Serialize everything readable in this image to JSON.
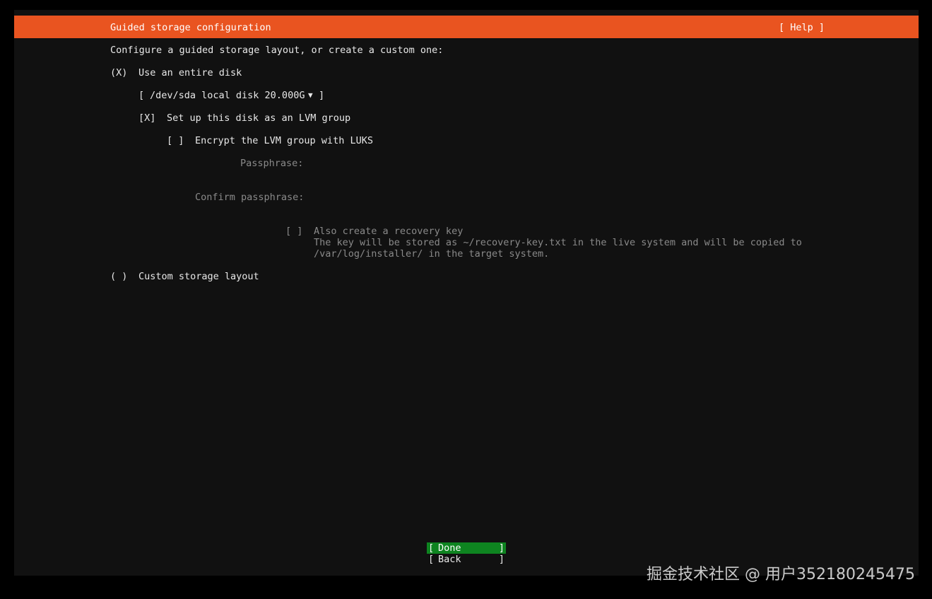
{
  "header": {
    "title": "Guided storage configuration",
    "help_label": "[ Help ]"
  },
  "main": {
    "intro": "Configure a guided storage layout, or create a custom one:",
    "entire_disk": {
      "mark": "(X)",
      "label": "Use an entire disk",
      "selected": true
    },
    "disk_select": {
      "open": "[",
      "value": "/dev/sda local disk 20.000G",
      "arrow": "▼",
      "close": "]"
    },
    "lvm": {
      "mark": "[X]",
      "label": "Set up this disk as an LVM group",
      "checked": true
    },
    "encrypt": {
      "mark": "[ ]",
      "label": "Encrypt the LVM group with LUKS",
      "checked": false
    },
    "passphrase": {
      "label": "Passphrase:",
      "value": ""
    },
    "confirm_passphrase": {
      "label": "Confirm passphrase:",
      "value": ""
    },
    "recovery_key": {
      "mark": "[ ]",
      "label": "Also create a recovery key",
      "help_line1": "The key will be stored as ~/recovery-key.txt in the live system and will be copied to",
      "help_line2": "/var/log/installer/ in the target system.",
      "checked": false
    },
    "custom_layout": {
      "mark": "( )",
      "label": "Custom storage layout",
      "selected": false
    }
  },
  "buttons": {
    "done": {
      "open": "[",
      "label": "Done",
      "close": "]"
    },
    "back": {
      "open": "[",
      "label": "Back",
      "close": "]"
    }
  },
  "watermark": "掘金技术社区 @ 用户352180245475",
  "colors": {
    "accent": "#e95420",
    "background": "#111111",
    "focus": "#0e8420",
    "text": "#e8e8e8",
    "disabled": "#8a8a8a"
  }
}
